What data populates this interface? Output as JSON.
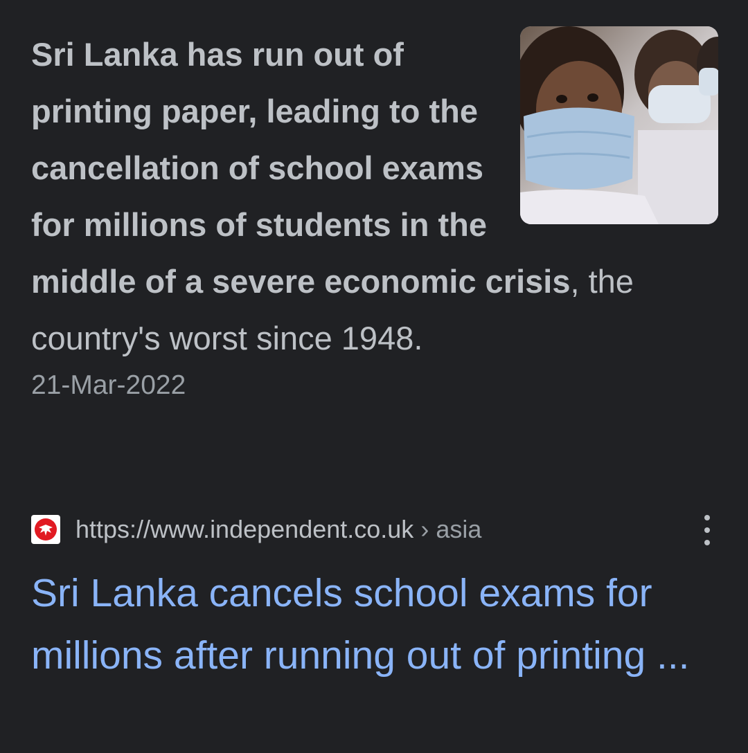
{
  "featured_snippet": {
    "answer_bold": "Sri Lanka has run out of printing paper, leading to the cancellation of school exams for millions of students in the middle of a severe economic crisis",
    "answer_rest": ", the country's worst since 1948.",
    "date": "21-Mar-2022",
    "thumbnail_icon": "students-in-masks-photo"
  },
  "result": {
    "favicon": "independent-eagle-icon",
    "url": "https://www.independent.co.uk",
    "url_separator": "›",
    "url_path": "asia",
    "title": "Sri Lanka cancels school exams for millions after running out of printing ..."
  },
  "colors": {
    "background": "#202124",
    "text": "#bdc1c6",
    "muted": "#9aa0a6",
    "link": "#8ab4f8",
    "favicon_red": "#e11a22"
  }
}
